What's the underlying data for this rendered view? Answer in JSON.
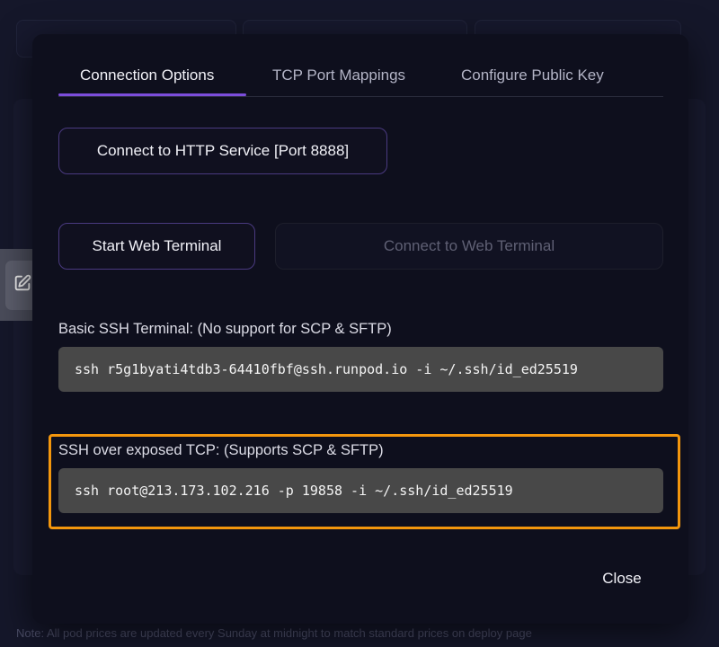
{
  "background": {
    "note_text": "Note: All pod prices are updated every Sunday at midnight to match standard prices on deploy page"
  },
  "modal": {
    "tabs": [
      {
        "label": "Connection Options",
        "active": true
      },
      {
        "label": "TCP Port Mappings",
        "active": false
      },
      {
        "label": "Configure Public Key",
        "active": false
      }
    ],
    "http_button_label": "Connect to HTTP Service [Port 8888]",
    "start_terminal_label": "Start Web Terminal",
    "connect_terminal_label": "Connect to Web Terminal",
    "basic_ssh": {
      "label": "Basic SSH Terminal: (No support for SCP & SFTP)",
      "command": "ssh r5g1byati4tdb3-64410fbf@ssh.runpod.io -i ~/.ssh/id_ed25519"
    },
    "tcp_ssh": {
      "label": "SSH over exposed TCP: (Supports SCP & SFTP)",
      "command": "ssh root@213.173.102.216 -p 19858 -i ~/.ssh/id_ed25519"
    },
    "close_label": "Close"
  },
  "colors": {
    "accent": "#7c4ddb",
    "highlight": "#f3960d",
    "modal_bg": "#0e0f1d",
    "code_bg": "#484848"
  },
  "icons": {
    "side_button": "edit-icon"
  }
}
